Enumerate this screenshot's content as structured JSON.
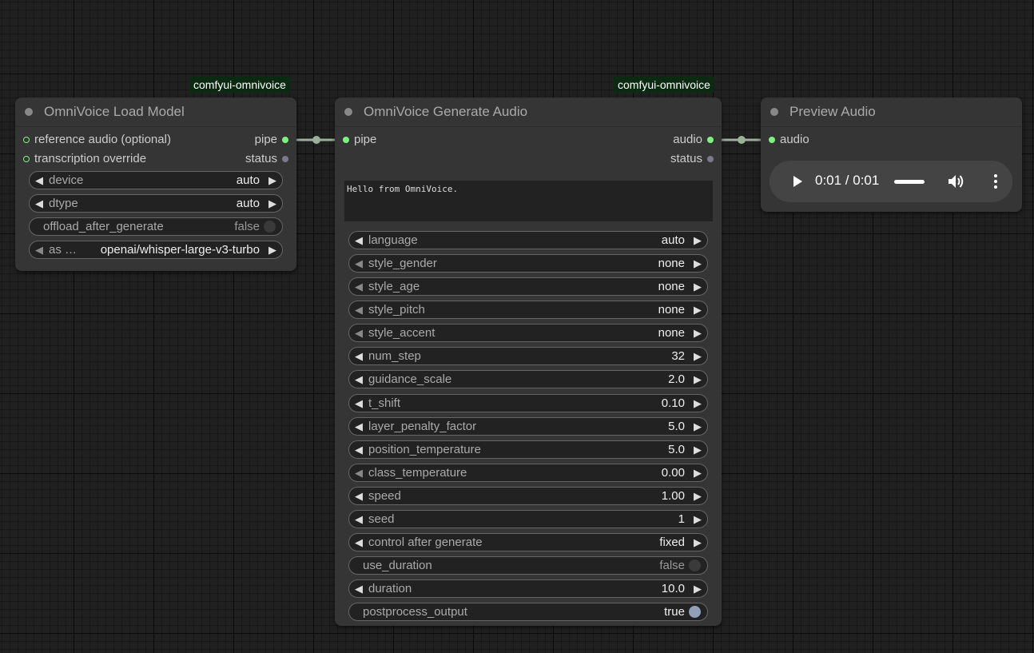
{
  "badges": {
    "load_model": "comfyui-omnivoice",
    "generate_audio": "comfyui-omnivoice"
  },
  "load_model": {
    "title": "OmniVoice Load Model",
    "inputs": [
      "reference audio (optional)",
      "transcription override"
    ],
    "outputs": [
      "pipe",
      "status"
    ],
    "widgets": {
      "device": {
        "label": "device",
        "value": "auto"
      },
      "dtype": {
        "label": "dtype",
        "value": "auto"
      },
      "offload": {
        "label": "offload_after_generate",
        "value": "false"
      },
      "asr": {
        "label": "as …",
        "value": "openai/whisper-large-v3-turbo"
      }
    }
  },
  "generate": {
    "title": "OmniVoice Generate Audio",
    "inputs": [
      "pipe"
    ],
    "outputs": [
      "audio",
      "status"
    ],
    "text": "Hello from OmniVoice.",
    "widgets": [
      {
        "label": "language",
        "value": "auto"
      },
      {
        "label": "style_gender",
        "value": "none"
      },
      {
        "label": "style_age",
        "value": "none"
      },
      {
        "label": "style_pitch",
        "value": "none"
      },
      {
        "label": "style_accent",
        "value": "none"
      },
      {
        "label": "num_step",
        "value": "32"
      },
      {
        "label": "guidance_scale",
        "value": "2.0"
      },
      {
        "label": "t_shift",
        "value": "0.10"
      },
      {
        "label": "layer_penalty_factor",
        "value": "5.0"
      },
      {
        "label": "position_temperature",
        "value": "5.0"
      },
      {
        "label": "class_temperature",
        "value": "0.00"
      },
      {
        "label": "speed",
        "value": "1.00"
      },
      {
        "label": "seed",
        "value": "1"
      },
      {
        "label": "control after generate",
        "value": "fixed"
      },
      {
        "label": "use_duration",
        "value": "false"
      },
      {
        "label": "duration",
        "value": "10.0"
      },
      {
        "label": "postprocess_output",
        "value": "true"
      }
    ]
  },
  "preview": {
    "title": "Preview Audio",
    "inputs": [
      "audio"
    ],
    "player": {
      "time": "0:01 / 0:01"
    }
  }
}
